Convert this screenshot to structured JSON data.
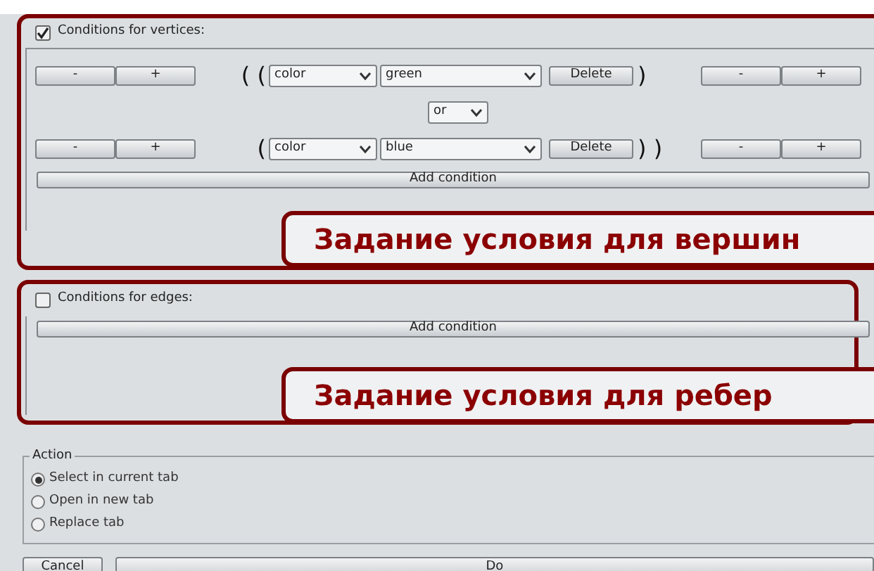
{
  "vertices": {
    "label": "Conditions for vertices:",
    "checked": true,
    "conditions": [
      {
        "minus": "-",
        "plus": "+",
        "open": "( (",
        "attribute": "color",
        "value": "green",
        "delete": "Delete",
        "close": ")",
        "minus_right": "-",
        "plus_right": "+"
      },
      {
        "minus": "-",
        "plus": "+",
        "open": "(",
        "attribute": "color",
        "value": "blue",
        "delete": "Delete",
        "close": ") )",
        "minus_right": "-",
        "plus_right": "+"
      }
    ],
    "operator": "or",
    "add_button": "Add condition",
    "annotation": "Задание условия для вершин"
  },
  "edges": {
    "label": "Conditions for edges:",
    "checked": false,
    "add_button": "Add condition",
    "annotation": "Задание условия для ребер"
  },
  "action": {
    "title": "Action",
    "options": [
      {
        "label": "Select in current tab",
        "selected": true
      },
      {
        "label": "Open in new tab",
        "selected": false
      },
      {
        "label": "Replace tab",
        "selected": false
      }
    ]
  },
  "buttons": {
    "cancel": "Cancel",
    "do": "Do"
  }
}
